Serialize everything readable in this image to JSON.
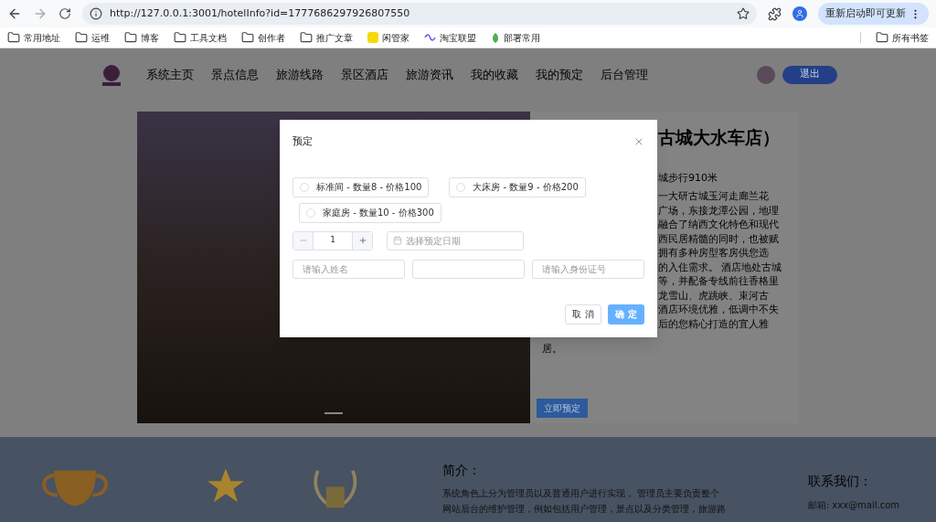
{
  "browser": {
    "url": "http://127.0.0.1:3001/hotelInfo?id=1777686297926807550",
    "update_button": "重新启动即可更新",
    "bookmarks": [
      {
        "label": "常用地址",
        "kind": "folder"
      },
      {
        "label": "运维",
        "kind": "folder"
      },
      {
        "label": "博客",
        "kind": "folder"
      },
      {
        "label": "工具文档",
        "kind": "folder"
      },
      {
        "label": "创作者",
        "kind": "folder"
      },
      {
        "label": "推广文章",
        "kind": "folder"
      },
      {
        "label": "闲管家",
        "kind": "app"
      },
      {
        "label": "淘宝联盟",
        "kind": "wave"
      },
      {
        "label": "部署常用",
        "kind": "leaf"
      }
    ],
    "all_bookmarks": "所有书签"
  },
  "nav": {
    "items": [
      "系统主页",
      "景点信息",
      "旅游线路",
      "景区酒店",
      "旅游资讯",
      "我的收藏",
      "我的预定",
      "后台管理"
    ],
    "logout": "退出"
  },
  "hotel": {
    "title": "古城大水车店）",
    "distance": "城步行910米",
    "description_lines": [
      "一大研古城玉河走廊兰花",
      "广场，东接龙潭公园，地理",
      "融合了纳西文化特色和现代",
      "西民居精髓的同时，也被赋",
      "拥有多种房型客房供您选",
      "的入住需求。 酒店地处古城",
      "等，并配备专线前往香格里",
      "龙雪山、虎跳峡、束河古",
      "酒店环境优雅，低调中不失",
      "后的您精心打造的宜人雅"
    ],
    "last_line": "居。",
    "book_button": "立即预定"
  },
  "modal": {
    "title": "预定",
    "room_options": [
      {
        "label": "标准间 - 数量8 - 价格100",
        "selected": false
      },
      {
        "label": "大床房 - 数量9 - 价格200",
        "selected": false
      },
      {
        "label": "家庭房 - 数量10 - 价格300",
        "selected": false
      }
    ],
    "quantity": "1",
    "date_placeholder": "选择预定日期",
    "fields": [
      {
        "kind": "text",
        "placeholder": "请输入姓名"
      },
      {
        "kind": "blank"
      },
      {
        "kind": "text",
        "placeholder": "请输入身份证号"
      }
    ],
    "cancel": "取 消",
    "confirm": "确 定"
  },
  "footer": {
    "intro_title": "简介：",
    "intro_lines": [
      "系统角色上分为管理员以及普通用户进行实现， 管理员主要负责整个",
      "网站后台的维护管理，例如包括用户管理，景点以及分类管理，旅游路"
    ],
    "contact_title": "联系我们：",
    "email": "邮箱: xxx@mail.com"
  }
}
